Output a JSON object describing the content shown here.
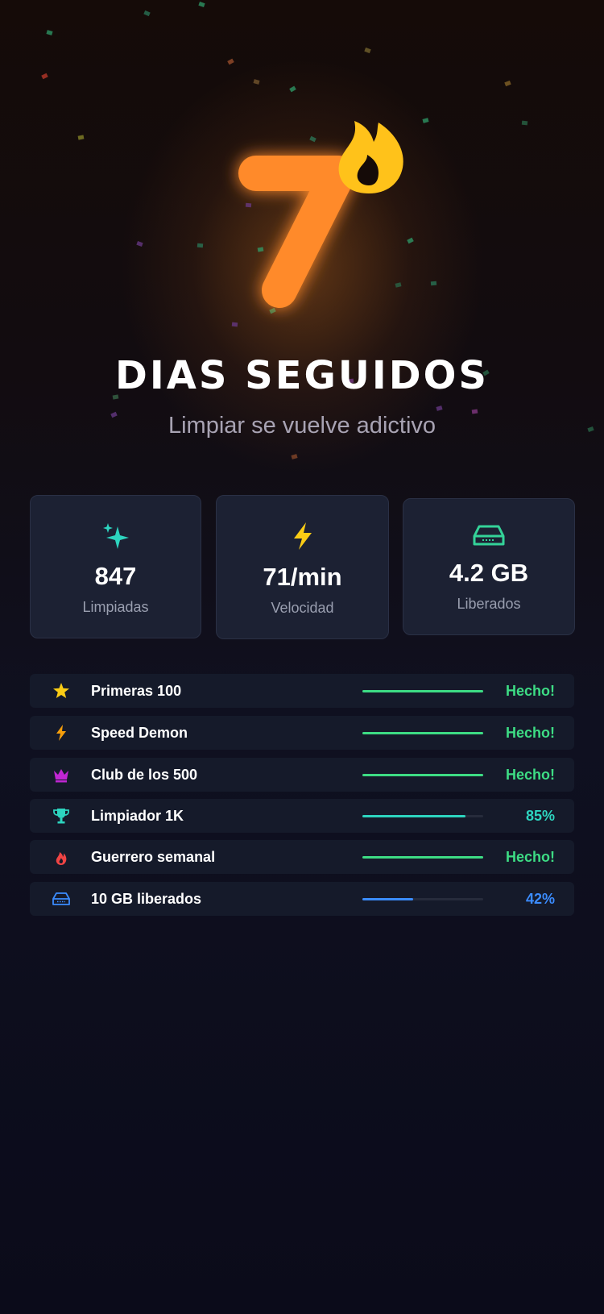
{
  "hero": {
    "streak_number": "7",
    "title": "DIAS SEGUIDOS",
    "subtitle": "Limpiar se vuelve adictivo"
  },
  "stats": [
    {
      "icon": "sparkles-icon",
      "value": "847",
      "label": "Limpiadas",
      "color": "#2dd4bf"
    },
    {
      "icon": "lightning-icon",
      "value": "71/min",
      "label": "Velocidad",
      "color": "#facc15"
    },
    {
      "icon": "drive-icon",
      "value": "4.2 GB",
      "label": "Liberados",
      "color": "#34d399"
    }
  ],
  "achievements": [
    {
      "icon": "star-icon",
      "name": "Primeras 100",
      "progress": 1.0,
      "status": "Hecho!",
      "color": "#3ddc84",
      "bar_color": "#3ddc84",
      "icon_color": "#facc15"
    },
    {
      "icon": "lightning-icon",
      "name": "Speed Demon",
      "progress": 1.0,
      "status": "Hecho!",
      "color": "#3ddc84",
      "bar_color": "#3ddc84",
      "icon_color": "#f59e0b"
    },
    {
      "icon": "crown-icon",
      "name": "Club de los 500",
      "progress": 1.0,
      "status": "Hecho!",
      "color": "#3ddc84",
      "bar_color": "#3ddc84",
      "icon_color": "#c026d3"
    },
    {
      "icon": "trophy-icon",
      "name": "Limpiador 1K",
      "progress": 0.85,
      "status": "85%",
      "color": "#2dd4bf",
      "bar_color": "#2dd4bf",
      "icon_color": "#2dd4bf"
    },
    {
      "icon": "flame-icon",
      "name": "Guerrero semanal",
      "progress": 1.0,
      "status": "Hecho!",
      "color": "#3ddc84",
      "bar_color": "#3ddc84",
      "icon_color": "#ef4444"
    },
    {
      "icon": "drive-icon",
      "name": "10 GB liberados",
      "progress": 0.42,
      "status": "42%",
      "color": "#3b8cff",
      "bar_color": "#3b8cff",
      "icon_color": "#3b8cff"
    }
  ],
  "colors": {
    "accent_orange": "#ff8a2a",
    "flame_yellow": "#ffc21a",
    "success_green": "#3ddc84"
  }
}
